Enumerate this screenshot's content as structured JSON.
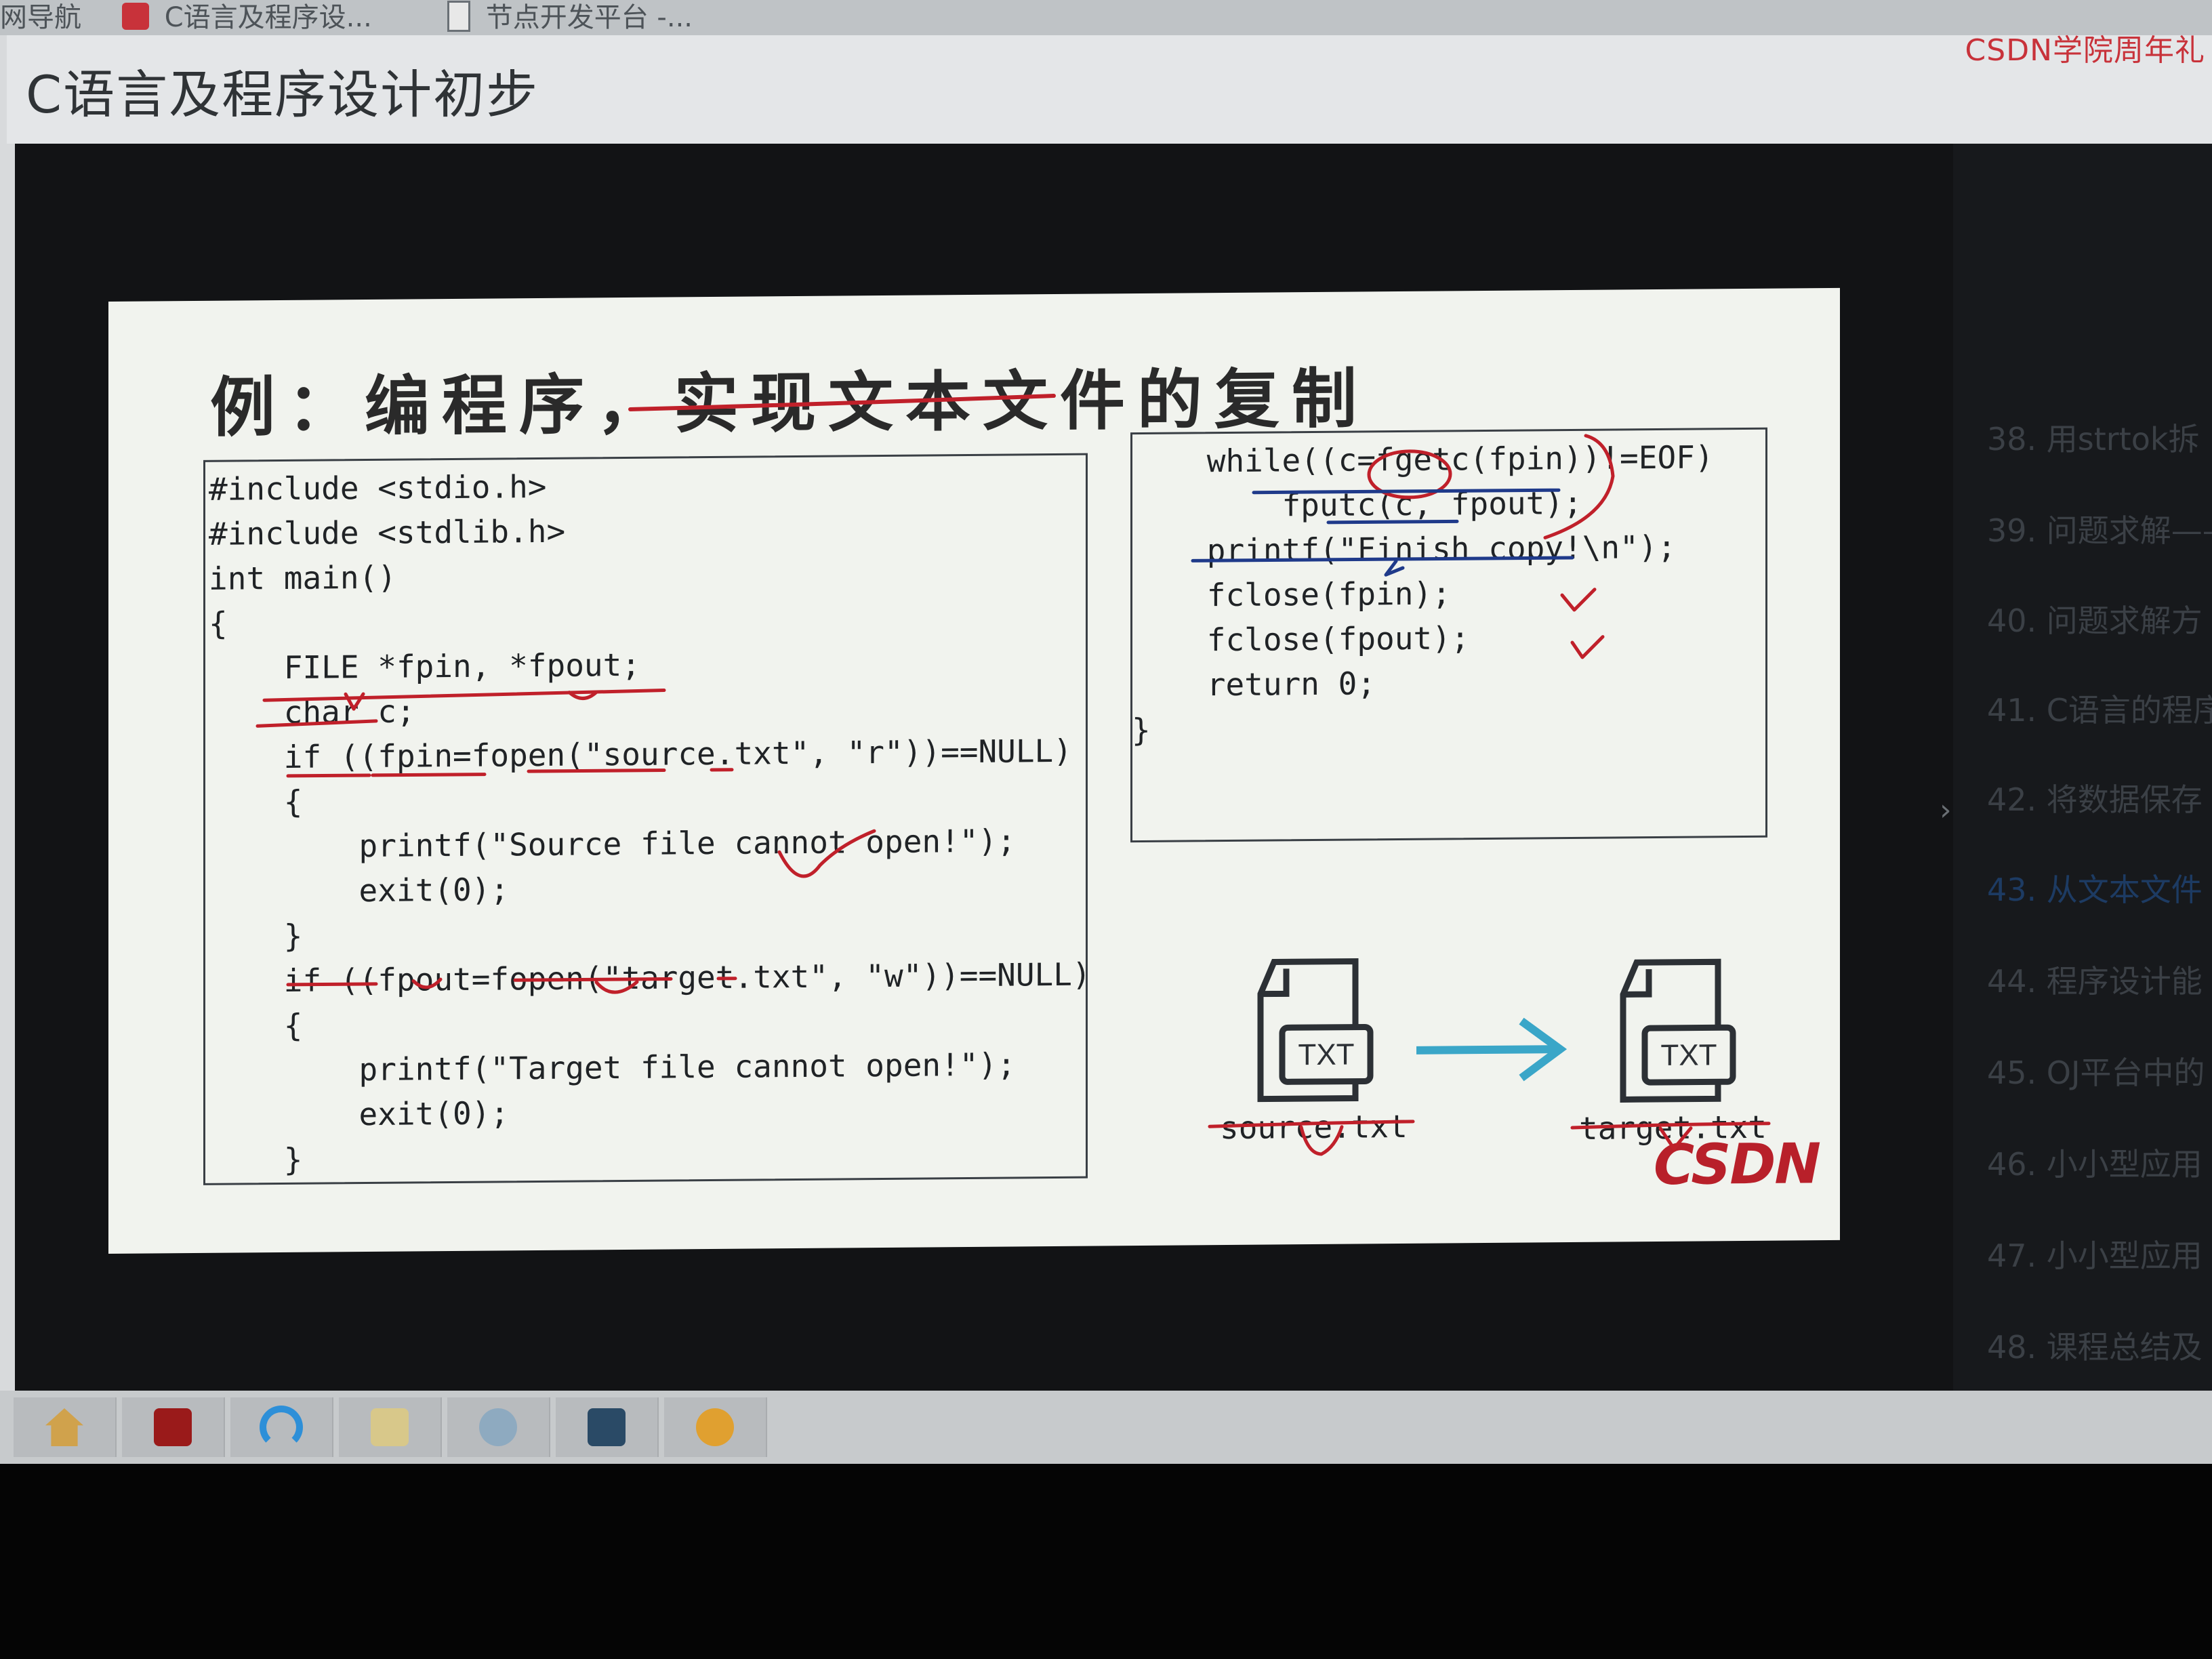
{
  "browser": {
    "tabs": [
      {
        "label": "网导航"
      },
      {
        "label": "C语言及程序设..."
      },
      {
        "label": "节点开发平台 -..."
      }
    ],
    "promo_text": "CSDN学院周年礼"
  },
  "course": {
    "title": "C语言及程序设计初步"
  },
  "slide": {
    "title": "例：编程序，实现文本文件的复制",
    "code_left": [
      "#include <stdio.h>",
      "#include <stdlib.h>",
      "int main()",
      "{",
      "    FILE *fpin, *fpout;",
      "    char c;",
      "    if ((fpin=fopen(\"source.txt\", \"r\"))==NULL)",
      "    {",
      "        printf(\"Source file cannot open!\");",
      "        exit(0);",
      "    }",
      "    if ((fpout=fopen(\"target.txt\", \"w\"))==NULL)",
      "    {",
      "        printf(\"Target file cannot open!\");",
      "        exit(0);",
      "    }"
    ],
    "code_right": [
      "    while((c=fgetc(fpin))!=EOF)",
      "        fputc(c, fpout);",
      "    printf(\"Finish copy!\\n\");",
      "    fclose(fpin);",
      "    fclose(fpout);",
      "    return 0;",
      "}"
    ],
    "source_icon_text": "TXT",
    "target_icon_text": "TXT",
    "source_label": "source.txt",
    "target_label": "target.txt",
    "logo": "CSDN"
  },
  "playlist": {
    "items": [
      {
        "label": "38. 用strtok拆"
      },
      {
        "label": "39. 问题求解——"
      },
      {
        "label": "40. 问题求解方"
      },
      {
        "label": "41. C语言的程序"
      },
      {
        "label": "42. 将数据保存"
      },
      {
        "label": "43. 从文本文件",
        "active": true
      },
      {
        "label": "44. 程序设计能"
      },
      {
        "label": "45. OJ平台中的"
      },
      {
        "label": "46. 小小型应用"
      },
      {
        "label": "47. 小小型应用"
      },
      {
        "label": "48. 课程总结及"
      }
    ],
    "arrow": "›"
  },
  "taskbar": {
    "icons": [
      "home-icon",
      "pdf-icon",
      "browser-icon",
      "folder-icon",
      "media-icon",
      "app-grid-icon",
      "swirl-icon"
    ]
  },
  "colors": {
    "brand_red": "#c8323a",
    "arrow_blue": "#3aa6c8",
    "annotation_red": "#c0202a",
    "annotation_blue": "#1f3a8a"
  }
}
